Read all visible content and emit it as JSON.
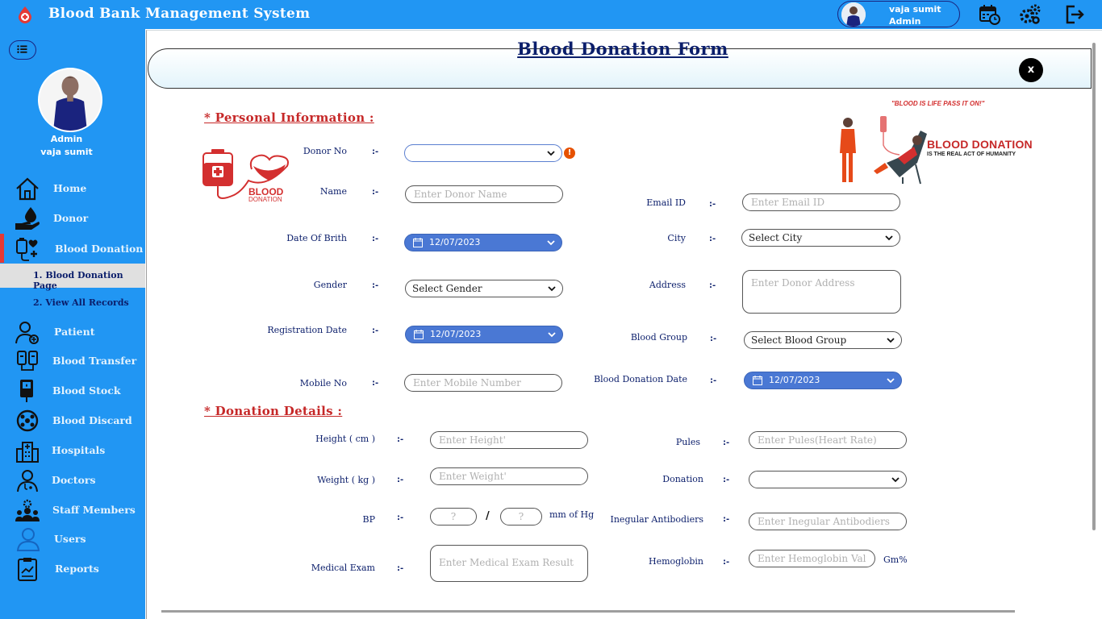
{
  "app": {
    "title": "Blood Bank Management System",
    "user_name": "vaja sumit",
    "user_role": "Admin"
  },
  "sidebar": {
    "profile_role": "Admin",
    "profile_name": "vaja sumit",
    "items": [
      {
        "label": "Home",
        "icon": "home-icon"
      },
      {
        "label": "Donor",
        "icon": "donor-icon"
      },
      {
        "label": "Blood Donation",
        "icon": "blood-donation-icon"
      },
      {
        "label": "Patient",
        "icon": "patient-icon"
      },
      {
        "label": "Blood Transfer",
        "icon": "blood-transfer-icon"
      },
      {
        "label": "Blood Stock",
        "icon": "blood-stock-icon"
      },
      {
        "label": "Blood Discard",
        "icon": "blood-discard-icon"
      },
      {
        "label": "Hospitals",
        "icon": "hospital-icon"
      },
      {
        "label": "Doctors",
        "icon": "doctor-icon"
      },
      {
        "label": "Staff Members",
        "icon": "staff-icon"
      },
      {
        "label": "Users",
        "icon": "users-icon"
      },
      {
        "label": "Reports",
        "icon": "reports-icon"
      }
    ],
    "sub_items": [
      {
        "label": "1.  Blood Donation Page"
      },
      {
        "label": "2. View All Records"
      }
    ]
  },
  "form": {
    "title": "Blood Donation Form",
    "close_label": "x",
    "personal_section": "*  Personal Information  :",
    "donation_section": "*  Donation Details  :",
    "separator": ":-",
    "fields": {
      "donor_no": {
        "label": "Donor No",
        "value": ""
      },
      "name": {
        "label": "Name",
        "placeholder": "Enter Donor Name"
      },
      "email": {
        "label": "Email ID",
        "placeholder": "Enter Email ID"
      },
      "dob": {
        "label": "Date Of Brith",
        "value": "12/07/2023"
      },
      "city": {
        "label": "City",
        "value": "Select City"
      },
      "gender": {
        "label": "Gender",
        "value": "Select Gender"
      },
      "address": {
        "label": "Address",
        "placeholder": "Enter Donor Address"
      },
      "registration_date": {
        "label": "Registration Date",
        "value": "12/07/2023"
      },
      "blood_group": {
        "label": "Blood Group",
        "value": "Select Blood Group"
      },
      "mobile": {
        "label": "Mobile No",
        "placeholder": "Enter Mobile Number"
      },
      "donation_date": {
        "label": "Blood Donation Date",
        "value": "12/07/2023"
      },
      "height": {
        "label": "Height ( cm )",
        "placeholder": "Enter Height'"
      },
      "pules": {
        "label": "Pules",
        "placeholder": "Enter Pules(Heart Rate)"
      },
      "weight": {
        "label": "Weight ( kg )",
        "placeholder": "Enter Weight'"
      },
      "donation": {
        "label": "Donation",
        "value": ""
      },
      "bp": {
        "label": "BP",
        "placeholder1": "?",
        "placeholder2": "?",
        "slash": "/",
        "unit": "mm of Hg"
      },
      "antibodies": {
        "label": "Inegular Antibodiers",
        "placeholder": "Enter Inegular Antibodiers"
      },
      "medical_exam": {
        "label": "Medical Exam",
        "placeholder": "Enter Medical Exam Result"
      },
      "hemoglobin": {
        "label": "Hemoglobin",
        "placeholder": "Enter Hemoglobin Value",
        "unit": "Gm%"
      }
    },
    "error_icon": "!"
  },
  "graphics": {
    "logo_word1": "BLOOD",
    "logo_word2": "DONATION",
    "banner_quote": "\"BLOOD IS LIFE PASS IT ON!\"",
    "banner_head": "BLOOD DONATION",
    "banner_sub": "IS THE REAL ACT OF HUMANITY"
  },
  "colors": {
    "primary": "#2196f3",
    "accent_red": "#c62828",
    "date_blue": "#4a78d4",
    "text_navy": "#0b1e6b"
  }
}
